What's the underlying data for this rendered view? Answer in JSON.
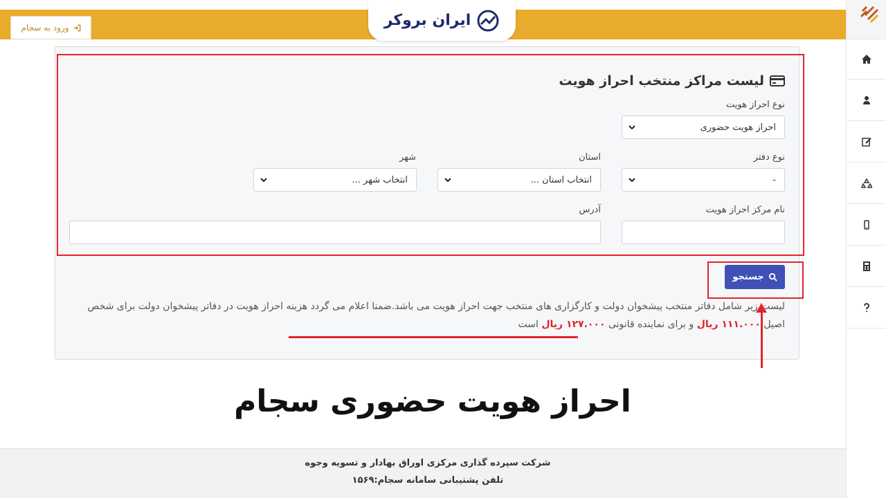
{
  "header": {
    "login_label": "ورود به سجام",
    "logo_text": "ایران بروکر",
    "bg_color": "#e8ab2c"
  },
  "sidebar": {
    "items": [
      {
        "icon": "home-icon"
      },
      {
        "icon": "user-icon"
      },
      {
        "icon": "edit-icon"
      },
      {
        "icon": "recycle-icon"
      },
      {
        "icon": "mobile-icon"
      },
      {
        "icon": "calculator-icon"
      },
      {
        "icon": "question-icon"
      }
    ]
  },
  "form": {
    "title": "لیست مراکز منتخب احراز هویت",
    "auth_type_label": "نوع احراز هویت",
    "auth_type_value": "احراز هویت حضوری",
    "office_type_label": "نوع دفتر",
    "office_type_value": "-",
    "province_label": "استان",
    "province_value": "انتخاب استان ...",
    "city_label": "شهر",
    "city_value": "انتخاب شهر ...",
    "center_name_label": "نام مرکز احراز هویت",
    "center_name_value": "",
    "address_label": "آدرس",
    "address_value": "",
    "search_label": "جستجو"
  },
  "notice": {
    "text_1": "لیست زیر شامل دفاتر منتخب پیشخوان دولت و کارگزاری های منتخب جهت احراز هویت می باشد.ضمنا اعلام می گردد هزینه احراز هویت در دفاتر پیشخوان دولت برای شخص اصیل",
    "price_1": "۱۱۱.۰۰۰ ریال",
    "text_2": "و برای نماینده قانونی",
    "price_2": "۱۲۷.۰۰۰ ریال",
    "text_3": "است"
  },
  "caption": "احراز هویت حضوری سجام",
  "footer": {
    "line_1": "شرکت سپرده گذاری مرکزی اوراق بهادار و تسویه وجوه",
    "line_2": "تلفن پشتیبانی سامانه سجام:۱۵۶۹"
  },
  "colors": {
    "accent": "#e8ab2c",
    "button": "#3f51b5",
    "highlight": "#e3242b"
  }
}
